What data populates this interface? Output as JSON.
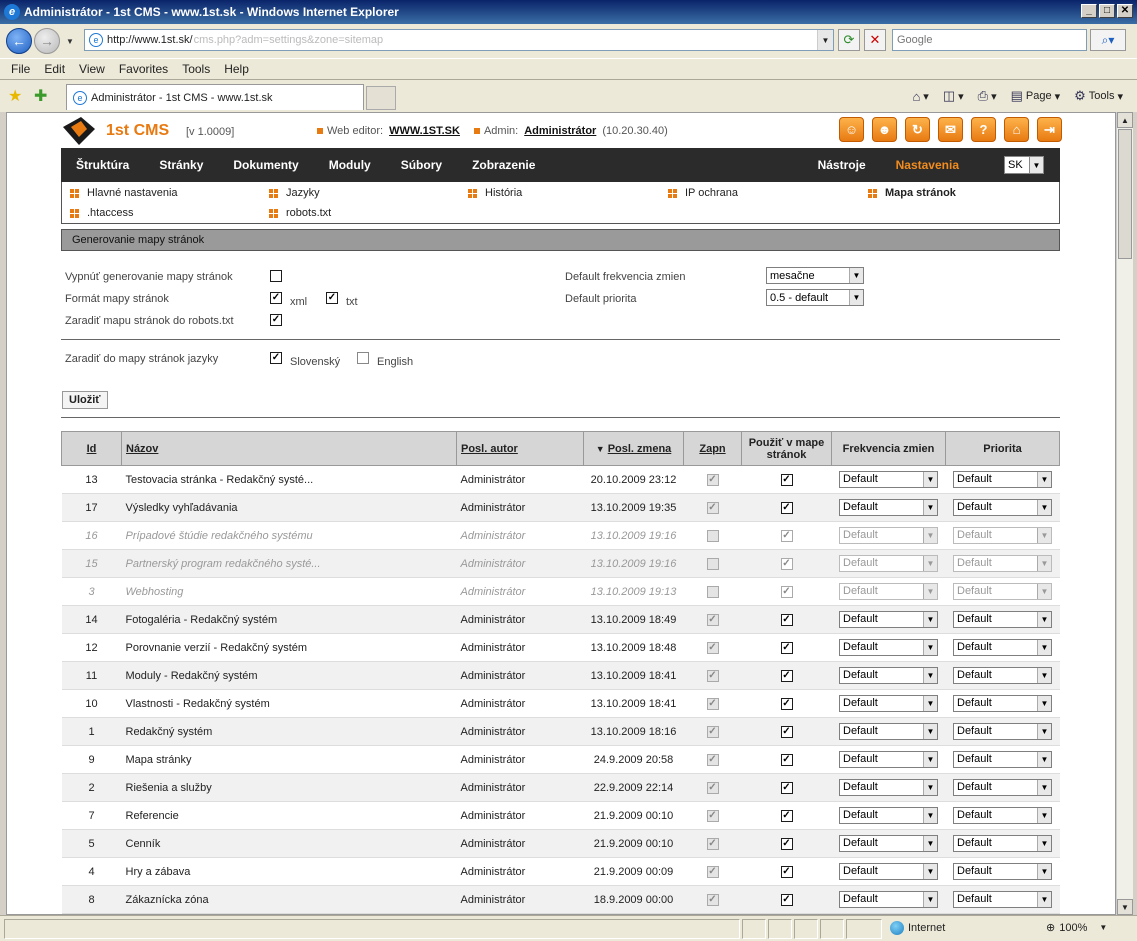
{
  "window": {
    "title": "Administrátor - 1st CMS - www.1st.sk - Windows Internet Explorer"
  },
  "address": {
    "url": "http://www.1st.sk/",
    "url_rest": "cms.php?adm=settings&zone=sitemap"
  },
  "search": {
    "placeholder": "Google"
  },
  "menu": [
    "File",
    "Edit",
    "View",
    "Favorites",
    "Tools",
    "Help"
  ],
  "tab": {
    "title": "Administrátor - 1st CMS - www.1st.sk"
  },
  "commandbar": {
    "page": "Page",
    "tools": "Tools"
  },
  "status": {
    "zone": "Internet",
    "zoom": "100%"
  },
  "cms": {
    "name": "1st CMS",
    "version": "[v 1.0009]",
    "web_editor_label": "Web editor:",
    "web_editor_value": "WWW.1ST.SK",
    "admin_label": "Admin:",
    "admin_value": "Administrátor",
    "admin_ip": "(10.20.30.40)"
  },
  "nav": {
    "items": [
      "Štruktúra",
      "Stránky",
      "Dokumenty",
      "Moduly",
      "Súbory",
      "Zobrazenie"
    ],
    "tools": "Nástroje",
    "settings": "Nastavenia",
    "lang": "SK"
  },
  "subnav": [
    "Hlavné nastavenia",
    "Jazyky",
    "História",
    "IP ochrana",
    "Mapa stránok",
    ".htaccess",
    "robots.txt"
  ],
  "section_title": "Generovanie mapy stránok",
  "form": {
    "disable_label": "Vypnúť generovanie mapy stránok",
    "format_label": "Formát mapy stránok",
    "xml": "xml",
    "txt": "txt",
    "robots_label": "Zaradiť mapu stránok do robots.txt",
    "freq_label": "Default frekvencia zmien",
    "freq_value": "mesačne",
    "prio_label": "Default priorita",
    "prio_value": "0.5 - default",
    "langs_label": "Zaradiť do mapy stránok jazyky",
    "lang_sk": "Slovenský",
    "lang_en": "English",
    "save": "Uložiť"
  },
  "table": {
    "headers": [
      "Id",
      "Názov",
      "Posl. autor",
      "Posl. zmena",
      "Zapn",
      "Použiť v mape stránok",
      "Frekvencia zmien",
      "Priorita"
    ],
    "sort_icon": "▼",
    "rows": [
      {
        "id": "13",
        "name": "Testovacia stránka - Redakčný systé...",
        "author": "Administrátor",
        "date": "20.10.2009 23:12",
        "on": true,
        "use": true,
        "freq": "Default",
        "prio": "Default",
        "dis": false
      },
      {
        "id": "17",
        "name": "Výsledky vyhľadávania",
        "author": "Administrátor",
        "date": "13.10.2009 19:35",
        "on": true,
        "use": true,
        "freq": "Default",
        "prio": "Default",
        "dis": false
      },
      {
        "id": "16",
        "name": "Prípadové štúdie redakčného systému",
        "author": "Administrátor",
        "date": "13.10.2009 19:16",
        "on": false,
        "use": true,
        "freq": "Default",
        "prio": "Default",
        "dis": true
      },
      {
        "id": "15",
        "name": "Partnerský program redakčného systé...",
        "author": "Administrátor",
        "date": "13.10.2009 19:16",
        "on": false,
        "use": true,
        "freq": "Default",
        "prio": "Default",
        "dis": true
      },
      {
        "id": "3",
        "name": "Webhosting",
        "author": "Administrátor",
        "date": "13.10.2009 19:13",
        "on": false,
        "use": true,
        "freq": "Default",
        "prio": "Default",
        "dis": true
      },
      {
        "id": "14",
        "name": "Fotogaléria - Redakčný systém",
        "author": "Administrátor",
        "date": "13.10.2009 18:49",
        "on": true,
        "use": true,
        "freq": "Default",
        "prio": "Default",
        "dis": false
      },
      {
        "id": "12",
        "name": "Porovnanie verzií - Redakčný systém",
        "author": "Administrátor",
        "date": "13.10.2009 18:48",
        "on": true,
        "use": true,
        "freq": "Default",
        "prio": "Default",
        "dis": false
      },
      {
        "id": "11",
        "name": "Moduly - Redakčný systém",
        "author": "Administrátor",
        "date": "13.10.2009 18:41",
        "on": true,
        "use": true,
        "freq": "Default",
        "prio": "Default",
        "dis": false
      },
      {
        "id": "10",
        "name": "Vlastnosti - Redakčný systém",
        "author": "Administrátor",
        "date": "13.10.2009 18:41",
        "on": true,
        "use": true,
        "freq": "Default",
        "prio": "Default",
        "dis": false
      },
      {
        "id": "1",
        "name": "Redakčný systém",
        "author": "Administrátor",
        "date": "13.10.2009 18:16",
        "on": true,
        "use": true,
        "freq": "Default",
        "prio": "Default",
        "dis": false
      },
      {
        "id": "9",
        "name": "Mapa stránky",
        "author": "Administrátor",
        "date": "24.9.2009 20:58",
        "on": true,
        "use": true,
        "freq": "Default",
        "prio": "Default",
        "dis": false
      },
      {
        "id": "2",
        "name": "Riešenia a služby",
        "author": "Administrátor",
        "date": "22.9.2009 22:14",
        "on": true,
        "use": true,
        "freq": "Default",
        "prio": "Default",
        "dis": false
      },
      {
        "id": "7",
        "name": "Referencie",
        "author": "Administrátor",
        "date": "21.9.2009 00:10",
        "on": true,
        "use": true,
        "freq": "Default",
        "prio": "Default",
        "dis": false
      },
      {
        "id": "5",
        "name": "Cenník",
        "author": "Administrátor",
        "date": "21.9.2009 00:10",
        "on": true,
        "use": true,
        "freq": "Default",
        "prio": "Default",
        "dis": false
      },
      {
        "id": "4",
        "name": "Hry a zábava",
        "author": "Administrátor",
        "date": "21.9.2009 00:09",
        "on": true,
        "use": true,
        "freq": "Default",
        "prio": "Default",
        "dis": false
      },
      {
        "id": "8",
        "name": "Zákaznícka zóna",
        "author": "Administrátor",
        "date": "18.9.2009 00:00",
        "on": true,
        "use": true,
        "freq": "Default",
        "prio": "Default",
        "dis": false
      }
    ]
  },
  "colors": {
    "accent": "#e87a12",
    "nav_bg": "#2b2b2b",
    "section_bar": "#9a9a9a"
  }
}
